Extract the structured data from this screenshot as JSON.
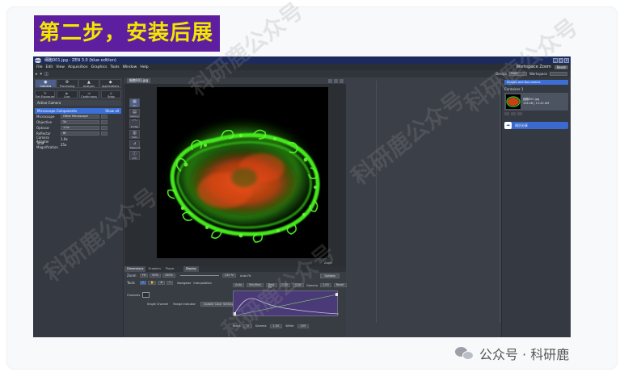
{
  "step_label": "第二步，安装后展示",
  "window": {
    "title": "细胞001.jpg - ZEN 3.0 (blue edition)",
    "logo": "zeiss",
    "controls": [
      "_",
      "□",
      "×"
    ]
  },
  "menu": {
    "items": [
      "File",
      "Edit",
      "View",
      "Acquisition",
      "Graphics",
      "Tools",
      "Window",
      "Help"
    ],
    "workspace_label": "Workspace Zoom",
    "reset_label": "Reset"
  },
  "toolbar": {
    "design_label": "Design",
    "design_value": "Dark",
    "workspace_label": "Workspace",
    "workspace_value": ""
  },
  "left_panel": {
    "tabs": [
      {
        "label": "Camera",
        "icon": "camera-icon",
        "glyph": "◉"
      },
      {
        "label": "Processing",
        "icon": "processing-icon",
        "glyph": "⚙"
      },
      {
        "label": "Analysis",
        "icon": "analysis-icon",
        "glyph": "▲"
      },
      {
        "label": "Applications",
        "icon": "applications-icon",
        "glyph": "◆"
      }
    ],
    "acq_buttons": [
      {
        "label": "Set Exposure",
        "glyph": "☰"
      },
      {
        "label": "Live",
        "glyph": "▶"
      },
      {
        "label": "Continuous",
        "glyph": "⇉"
      },
      {
        "label": "Snap",
        "glyph": "◎"
      }
    ],
    "active_camera": "Active Camera",
    "components_header": "Microscope Components",
    "components_show_all": "Show all",
    "props": [
      {
        "label": "Microscope",
        "value": "Other Microscope"
      },
      {
        "label": "Objective",
        "value": "5x"
      },
      {
        "label": "Optovar",
        "value": "1.0x"
      },
      {
        "label": "Reflector",
        "value": "Bf"
      },
      {
        "label": "Camera Adapter",
        "value": "1.0x"
      },
      {
        "label": "Total Magnification",
        "value": "25x"
      }
    ]
  },
  "document": {
    "tab": "细胞001.jpg"
  },
  "view_buttons": [
    {
      "label": "2D",
      "glyph": "▦"
    },
    {
      "label": "Gallery",
      "glyph": "▤"
    },
    {
      "label": "Profile",
      "glyph": "⌒"
    },
    {
      "label": "Histo",
      "glyph": "▥"
    },
    {
      "label": "Measure",
      "glyph": "⊿"
    },
    {
      "label": "Info",
      "glyph": "ⓘ"
    }
  ],
  "zoom_text": "Zoom",
  "bottom": {
    "tabs": [
      "Dimensions",
      "Graphics",
      "Player"
    ],
    "display_tab": "Display",
    "zoom_label": "Zoom",
    "zoom_pills": [
      "Fit",
      "50%",
      "100%"
    ],
    "zoom_value": "120 %",
    "autofit_label": "Auto Fit",
    "tools_label": "Tools",
    "tools_pills": [
      "⌖",
      "✋",
      "⊕",
      "⌗"
    ],
    "navigator_label": "Navigator",
    "interpolation_label": "Interpolation",
    "options_label": "Options",
    "channels_label": "Channels",
    "single_channel_label": "Single Channel",
    "range_indicator_label": "Range Indicator",
    "update_color_label": "Update Color Settings",
    "histo_top": [
      "Auto",
      "Min/Max",
      "Best Fit",
      "0.00",
      "0.00",
      "Gamma",
      "1.00",
      "Reset"
    ],
    "histo_bottom": [
      "Black",
      "0",
      "Gamma",
      "1.00",
      "White",
      "255"
    ]
  },
  "right_panel": {
    "header": "Images and Documents",
    "container_label": "Container 1",
    "thumb_name": "细胞001.jpg",
    "thumb_meta": "156 kB | 11:42 AM",
    "share_label": "知识分享"
  },
  "watermarks": [
    "科研鹿公众号",
    "科研鹿公众号",
    "科研鹿公众号",
    "科研鹿公众号",
    "科研鹿公众号"
  ],
  "footer": {
    "brand": "公众号 · 科研鹿"
  },
  "colors": {
    "label_bg": "#5e1ea0",
    "label_text": "#f3e600",
    "accent_blue": "#3b6fd6",
    "app_bg": "#3b4048"
  }
}
